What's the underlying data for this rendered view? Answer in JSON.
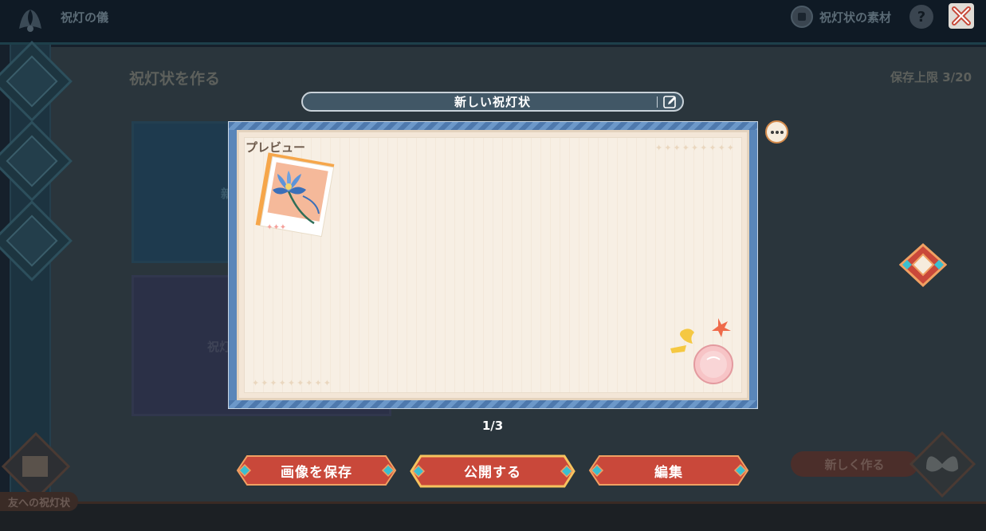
{
  "app": {
    "title": "祝灯の儀",
    "materials_label": "祝灯状の素材",
    "help_glyph": "?"
  },
  "background": {
    "heading": "祝灯状を作る",
    "save_limit": "保存上限 3/20",
    "card_label_1": "新",
    "card_label_2": "祝灯",
    "new_button_label": "新しく作る",
    "bottom_tab_label": "友への祝灯状"
  },
  "modal": {
    "name": "新しい祝灯状",
    "preview_label": "プレビュー",
    "stars": "✦✦✦✦✦✦✦✦✦",
    "page_indicator": "1/3",
    "buttons": {
      "save_image": "画像を保存",
      "publish": "公開する",
      "edit": "編集"
    }
  },
  "colors": {
    "button_red": "#c9483a",
    "button_border": "#f0a062",
    "accent_teal": "#3bbfd0",
    "frame_blue": "#5a86b9",
    "paper": "#f3e6d7"
  },
  "icons": {
    "close": "close-x-icon",
    "help": "help-icon",
    "materials": "materials-icon",
    "edit_name": "edit-pencil-icon",
    "more": "more-dots-icon"
  }
}
